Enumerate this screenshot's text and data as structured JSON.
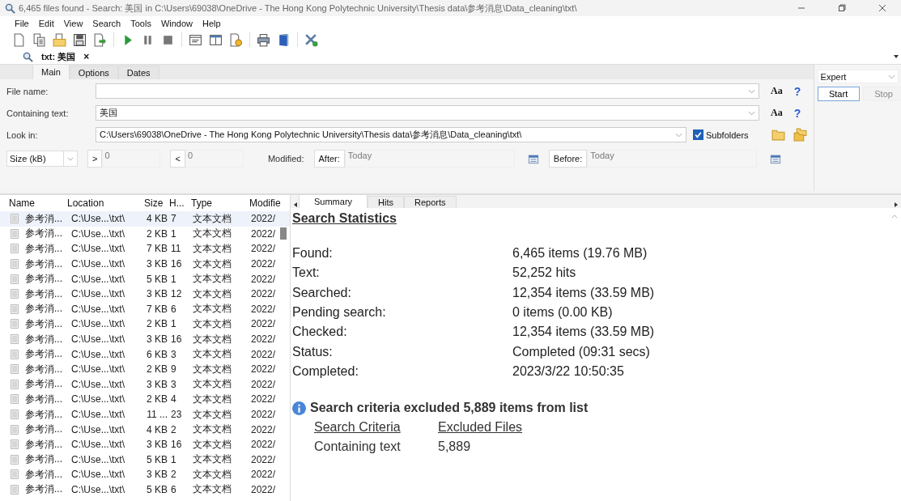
{
  "window": {
    "title": "6,465 files found - Search: 美国 in C:\\Users\\69038\\OneDrive - The Hong Kong Polytechnic University\\Thesis data\\参考消息\\Data_cleaning\\txt\\"
  },
  "menu": [
    "File",
    "Edit",
    "View",
    "Search",
    "Tools",
    "Window",
    "Help"
  ],
  "doc_tab": {
    "label": "txt: 美国",
    "close": "×"
  },
  "form_tabs": [
    {
      "label": "Main",
      "selected": true
    },
    {
      "label": "Options",
      "selected": false
    },
    {
      "label": "Dates",
      "selected": false
    }
  ],
  "form": {
    "file_name": {
      "label": "File name:",
      "match_case": "Aa",
      "help": "?"
    },
    "containing_text": {
      "label": "Containing text:",
      "value": "美国",
      "match_case": "Aa",
      "help": "?"
    },
    "look_in": {
      "label": "Look in:",
      "value": "C:\\Users\\69038\\OneDrive - The Hong Kong Polytechnic University\\Thesis data\\参考消息\\Data_cleaning\\txt\\"
    },
    "subfolders": {
      "label": "Subfolders",
      "checked": true
    },
    "size_filter": {
      "value": "Size (kB)"
    },
    "greater": {
      "label": ">",
      "placeholder": "0"
    },
    "less": {
      "label": "<",
      "placeholder": "0"
    },
    "modified_label": "Modified:",
    "after": {
      "label": "After:",
      "placeholder": "Today"
    },
    "before": {
      "label": "Before:",
      "placeholder": "Today"
    }
  },
  "mode": {
    "value": "Expert"
  },
  "buttons": [
    {
      "label": "Start",
      "disabled": false
    },
    {
      "label": "Stop",
      "disabled": true
    }
  ],
  "results": {
    "columns": [
      "Name",
      "Location",
      "Size",
      "H...",
      "Type",
      "Modifie"
    ],
    "rows": [
      {
        "name": "参考消...",
        "location": "C:\\Use...\\txt\\",
        "size": "4 KB",
        "hits": "7",
        "type": "文本文档",
        "modified": "2022/",
        "selected": true
      },
      {
        "name": "参考消...",
        "location": "C:\\Use...\\txt\\",
        "size": "2 KB",
        "hits": "1",
        "type": "文本文档",
        "modified": "2022/",
        "selected": false
      },
      {
        "name": "参考消...",
        "location": "C:\\Use...\\txt\\",
        "size": "7 KB",
        "hits": "11",
        "type": "文本文档",
        "modified": "2022/",
        "selected": false
      },
      {
        "name": "参考消...",
        "location": "C:\\Use...\\txt\\",
        "size": "3 KB",
        "hits": "16",
        "type": "文本文档",
        "modified": "2022/",
        "selected": false
      },
      {
        "name": "参考消...",
        "location": "C:\\Use...\\txt\\",
        "size": "5 KB",
        "hits": "1",
        "type": "文本文档",
        "modified": "2022/",
        "selected": false
      },
      {
        "name": "参考消...",
        "location": "C:\\Use...\\txt\\",
        "size": "3 KB",
        "hits": "12",
        "type": "文本文档",
        "modified": "2022/",
        "selected": false
      },
      {
        "name": "参考消...",
        "location": "C:\\Use...\\txt\\",
        "size": "7 KB",
        "hits": "6",
        "type": "文本文档",
        "modified": "2022/",
        "selected": false
      },
      {
        "name": "参考消...",
        "location": "C:\\Use...\\txt\\",
        "size": "2 KB",
        "hits": "1",
        "type": "文本文档",
        "modified": "2022/",
        "selected": false
      },
      {
        "name": "参考消...",
        "location": "C:\\Use...\\txt\\",
        "size": "3 KB",
        "hits": "16",
        "type": "文本文档",
        "modified": "2022/",
        "selected": false
      },
      {
        "name": "参考消...",
        "location": "C:\\Use...\\txt\\",
        "size": "6 KB",
        "hits": "3",
        "type": "文本文档",
        "modified": "2022/",
        "selected": false
      },
      {
        "name": "参考消...",
        "location": "C:\\Use...\\txt\\",
        "size": "2 KB",
        "hits": "9",
        "type": "文本文档",
        "modified": "2022/",
        "selected": false
      },
      {
        "name": "参考消...",
        "location": "C:\\Use...\\txt\\",
        "size": "3 KB",
        "hits": "3",
        "type": "文本文档",
        "modified": "2022/",
        "selected": false
      },
      {
        "name": "参考消...",
        "location": "C:\\Use...\\txt\\",
        "size": "2 KB",
        "hits": "4",
        "type": "文本文档",
        "modified": "2022/",
        "selected": false
      },
      {
        "name": "参考消...",
        "location": "C:\\Use...\\txt\\",
        "size": "11 ...",
        "hits": "23",
        "type": "文本文档",
        "modified": "2022/",
        "selected": false
      },
      {
        "name": "参考消...",
        "location": "C:\\Use...\\txt\\",
        "size": "4 KB",
        "hits": "2",
        "type": "文本文档",
        "modified": "2022/",
        "selected": false
      },
      {
        "name": "参考消...",
        "location": "C:\\Use...\\txt\\",
        "size": "3 KB",
        "hits": "16",
        "type": "文本文档",
        "modified": "2022/",
        "selected": false
      },
      {
        "name": "参考消...",
        "location": "C:\\Use...\\txt\\",
        "size": "5 KB",
        "hits": "1",
        "type": "文本文档",
        "modified": "2022/",
        "selected": false
      },
      {
        "name": "参考消...",
        "location": "C:\\Use...\\txt\\",
        "size": "3 KB",
        "hits": "2",
        "type": "文本文档",
        "modified": "2022/",
        "selected": false
      },
      {
        "name": "参考消...",
        "location": "C:\\Use...\\txt\\",
        "size": "5 KB",
        "hits": "6",
        "type": "文本文档",
        "modified": "2022/",
        "selected": false
      }
    ]
  },
  "summary": {
    "tabs": [
      {
        "label": "Summary",
        "selected": true
      },
      {
        "label": "Hits",
        "selected": false
      },
      {
        "label": "Reports",
        "selected": false
      }
    ],
    "heading": "Search Statistics",
    "stats": [
      {
        "label": "Found:",
        "value": "6,465 items (19.76 MB)"
      },
      {
        "label": "Text:",
        "value": "52,252 hits"
      },
      {
        "label": "Searched:",
        "value": "12,354 items (33.59 MB)"
      },
      {
        "label": "Pending search:",
        "value": "0 items (0.00 KB)"
      },
      {
        "label": "Checked:",
        "value": "12,354 items (33.59 MB)"
      },
      {
        "label": "Status:",
        "value": "Completed (09:31 secs)"
      },
      {
        "label": "Completed:",
        "value": "2023/3/22 10:50:35"
      }
    ],
    "notice": "Search criteria excluded 5,889 items from list",
    "criteria_columns": [
      "Search Criteria",
      "Excluded Files"
    ],
    "criteria_rows": [
      {
        "criterion": "Containing text",
        "excluded": "5,889"
      }
    ]
  }
}
